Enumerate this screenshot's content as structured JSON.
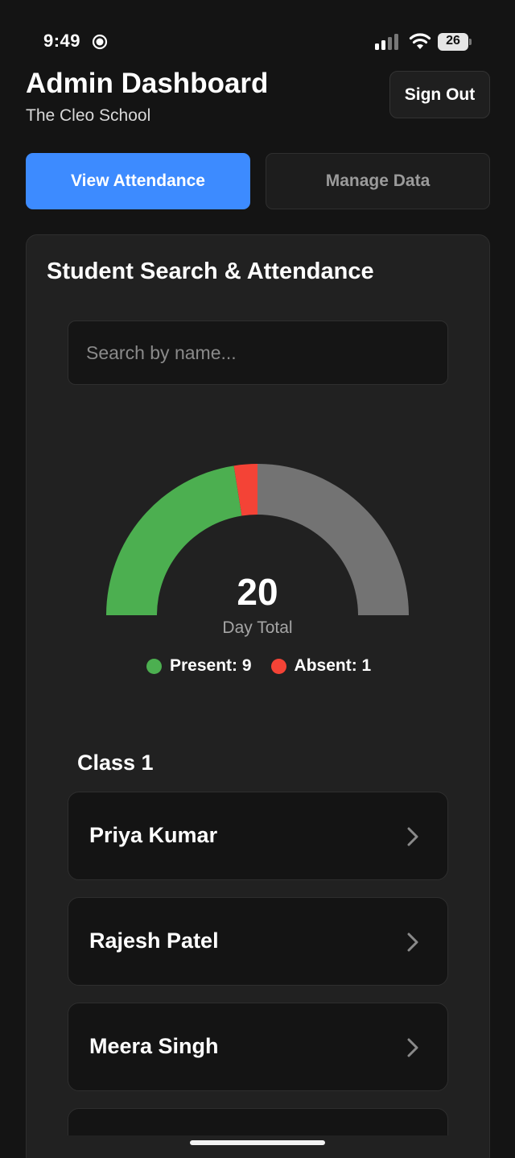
{
  "status_bar": {
    "time": "9:49",
    "battery": "26"
  },
  "header": {
    "title": "Admin Dashboard",
    "subtitle": "The Cleo School",
    "sign_out_label": "Sign Out"
  },
  "tabs": [
    {
      "label": "View Attendance",
      "active": true
    },
    {
      "label": "Manage Data",
      "active": false
    }
  ],
  "card": {
    "title": "Student Search & Attendance",
    "search_placeholder": "Search by name..."
  },
  "attendance": {
    "total": "20",
    "total_label": "Day Total",
    "present_label": "Present: 9",
    "absent_label": "Absent: 1",
    "present": 9,
    "absent": 1,
    "total_count": 20
  },
  "colors": {
    "present": "#4caf50",
    "absent": "#f44336",
    "remaining": "#737373",
    "accent": "#3d8bff"
  },
  "class_section": {
    "heading": "Class 1",
    "students": [
      {
        "name": "Priya Kumar"
      },
      {
        "name": "Rajesh Patel"
      },
      {
        "name": "Meera Singh"
      },
      {
        "name": ""
      }
    ]
  }
}
